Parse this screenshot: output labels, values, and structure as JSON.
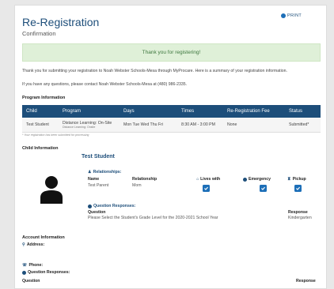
{
  "header": {
    "title": "Re-Registration",
    "subtitle": "Confirmation",
    "print_label": "PRINT"
  },
  "alert": {
    "message": "Thank you for registering!"
  },
  "intro": {
    "line1": "Thank you for submitting your registration to Noah Webster Schools-Mesa through MyProcare. Here is a summary of your registration information.",
    "line2": "If you have any questions, please contact Noah Webster Schools-Mesa at (480) 986-2335."
  },
  "program_section": {
    "title": "Program Information",
    "columns": [
      "Child",
      "Program",
      "Days",
      "Times",
      "Re-Registration Fee",
      "Status"
    ],
    "rows": [
      {
        "child": "Test Student",
        "program": "Distance Learning: On-Site",
        "program_sub": "Distance Learning: Onsite",
        "days": "Mon Tue Wed Thu Fri",
        "times": "8:30 AM - 3:00 PM",
        "fee": "None",
        "status": "Submitted*"
      }
    ],
    "footnote": "* Your registration has been submitted for processing"
  },
  "child_section": {
    "title": "Child Information",
    "student_name": "Test Student",
    "relationships_label": "Relationships:",
    "rel_headers": {
      "name": "Name",
      "relationship": "Relationship",
      "lives_with": "Lives with",
      "emergency": "Emergency",
      "pickup": "Pickup"
    },
    "rel_row": {
      "name": "Test Parent",
      "relationship": "Mom",
      "lives_with": true,
      "emergency": true,
      "pickup": true
    },
    "question_label": "Question Responses:",
    "q_headers": {
      "question": "Question",
      "response": "Response"
    },
    "q_row": {
      "question": "Please Select the Student's Grade Level for the 2020-2021 School Year",
      "response": "Kindergarten"
    }
  },
  "account_section": {
    "title": "Account Information",
    "address_label": "Address:",
    "phone_label": "Phone:",
    "question_label": "Question Responses:",
    "q_headers": {
      "question": "Question",
      "response": "Response"
    }
  }
}
